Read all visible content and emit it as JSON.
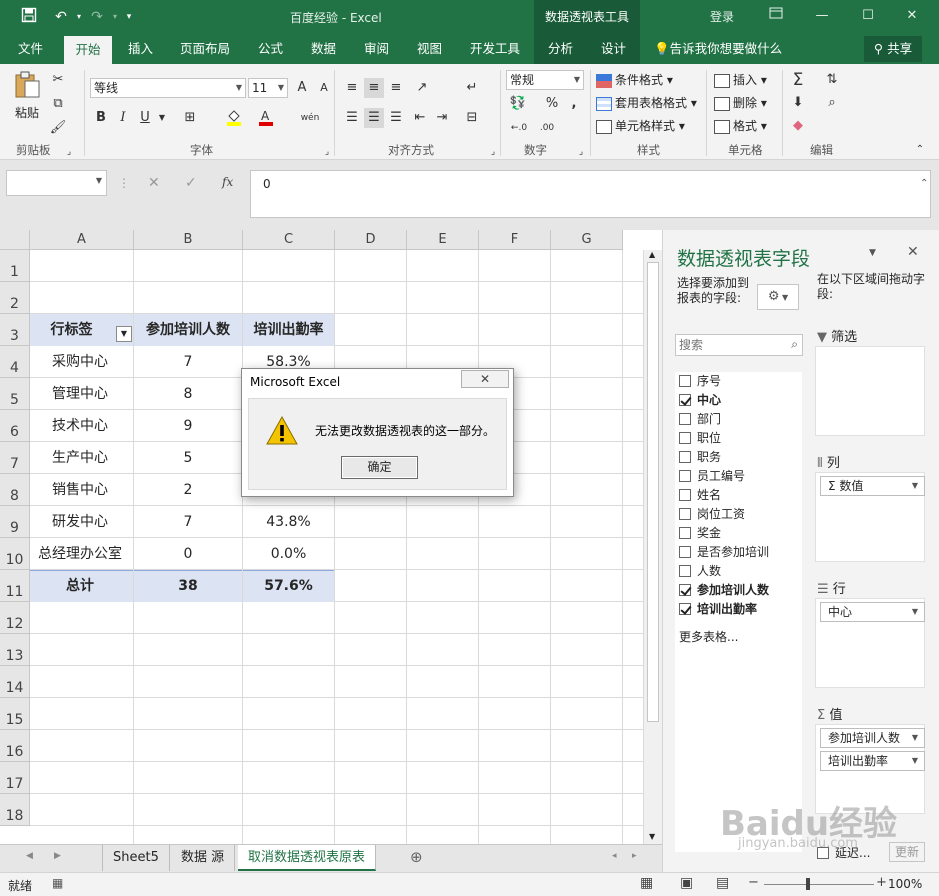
{
  "titlebar": {
    "title": "百度经验  -  Excel",
    "context_tools": "数据透视表工具",
    "login": "登录",
    "controls": [
      "restore-icon",
      "minimize-icon",
      "maximize-icon",
      "close-icon"
    ]
  },
  "tabs": {
    "items": [
      "文件",
      "开始",
      "插入",
      "页面布局",
      "公式",
      "数据",
      "审阅",
      "视图",
      "开发工具",
      "分析",
      "设计"
    ],
    "active": "开始",
    "tell_me": "告诉我你想要做什么",
    "share": "共享"
  },
  "ribbon": {
    "clipboard": {
      "paste": "粘贴",
      "label": "剪贴板"
    },
    "font": {
      "name": "等线",
      "size": "11",
      "label": "字体",
      "bold": "B",
      "italic": "I",
      "underline": "U",
      "grow": "A",
      "shrink": "A",
      "phonetic": "wén"
    },
    "alignment": {
      "label": "对齐方式"
    },
    "number": {
      "format": "常规",
      "label": "数字",
      "percent": "%",
      "comma": ",",
      "inc_decimal": "←.0",
      "dec_decimal": ".00"
    },
    "styles": {
      "conditional": "条件格式",
      "table": "套用表格格式",
      "cell": "单元格样式",
      "label": "样式"
    },
    "cells": {
      "insert": "插入",
      "delete": "删除",
      "format": "格式",
      "label": "单元格"
    },
    "editing": {
      "label": "编辑"
    }
  },
  "formula_bar": {
    "name_box": "",
    "fx": "fx",
    "value": "0"
  },
  "grid": {
    "columns": [
      "A",
      "B",
      "C",
      "D",
      "E",
      "F",
      "G"
    ],
    "rows": [
      "1",
      "2",
      "3",
      "4",
      "5",
      "6",
      "7",
      "8",
      "9",
      "10",
      "11",
      "12",
      "13",
      "14",
      "15",
      "16",
      "17",
      "18"
    ],
    "pivot": {
      "header": [
        "行标签",
        "参加培训人数",
        "培训出勤率"
      ],
      "rows": [
        [
          "采购中心",
          "7",
          "58.3%"
        ],
        [
          "管理中心",
          "8",
          ""
        ],
        [
          "技术中心",
          "9",
          ""
        ],
        [
          "生产中心",
          "5",
          ""
        ],
        [
          "销售中心",
          "2",
          ""
        ],
        [
          "研发中心",
          "7",
          "43.8%"
        ],
        [
          "总经理办公室",
          "0",
          "0.0%"
        ]
      ],
      "total": [
        "总计",
        "38",
        "57.6%"
      ]
    }
  },
  "sheets": {
    "tabs": [
      "Sheet5",
      "数据 源",
      "取消数据透视表原表"
    ],
    "active": "取消数据透视表原表"
  },
  "status": {
    "ready": "就绪",
    "zoom": "100%"
  },
  "pivot_panel": {
    "title": "数据透视表字段",
    "choose": "选择要添加到报表的字段:",
    "drag": "在以下区域间拖动字段:",
    "search_placeholder": "搜索",
    "fields": [
      {
        "name": "序号",
        "checked": false
      },
      {
        "name": "中心",
        "checked": true
      },
      {
        "name": "部门",
        "checked": false
      },
      {
        "name": "职位",
        "checked": false
      },
      {
        "name": "职务",
        "checked": false
      },
      {
        "name": "员工编号",
        "checked": false
      },
      {
        "name": "姓名",
        "checked": false
      },
      {
        "name": "岗位工资",
        "checked": false
      },
      {
        "name": "奖金",
        "checked": false
      },
      {
        "name": "是否参加培训",
        "checked": false
      },
      {
        "name": "人数",
        "checked": false
      },
      {
        "name": "参加培训人数",
        "checked": true
      },
      {
        "name": "培训出勤率",
        "checked": true
      }
    ],
    "more_tables": "更多表格...",
    "zones": {
      "filters": "筛选",
      "columns": "列",
      "rows": "行",
      "values": "值",
      "columns_chip": "Σ 数值",
      "rows_chip": "中心",
      "values_chips": [
        "参加培训人数",
        "培训出勤率"
      ]
    },
    "defer": "延迟...",
    "update": "更新"
  },
  "dialog": {
    "title": "Microsoft Excel",
    "message": "无法更改数据透视表的这一部分。",
    "ok": "确定",
    "close": "✕"
  },
  "watermark": {
    "logo": "Baidu经验",
    "url": "jingyan.baidu.com"
  },
  "colors": {
    "excel_green": "#217346",
    "pivot_header": "#dce3f2",
    "warning": "#f5c400"
  }
}
